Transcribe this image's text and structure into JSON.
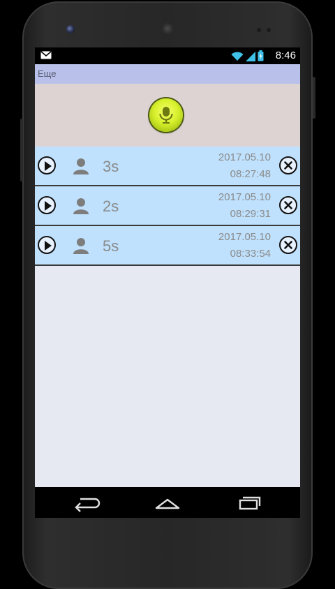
{
  "statusbar": {
    "time": "8:46",
    "icons": [
      "gmail-icon",
      "wifi-icon",
      "signal-icon",
      "battery-icon"
    ]
  },
  "actionbar": {
    "label": "Еще"
  },
  "recorder": {
    "button_icon": "microphone-icon",
    "accent": "#d7f02c"
  },
  "recordings": [
    {
      "duration": "3s",
      "date": "2017.05.10",
      "time": "08:27:48"
    },
    {
      "duration": "2s",
      "date": "2017.05.10",
      "time": "08:29:31"
    },
    {
      "duration": "5s",
      "date": "2017.05.10",
      "time": "08:33:54"
    }
  ],
  "colors": {
    "actionbar": "#b9c1ea",
    "record_area": "#ddd3d3",
    "row": "#bfe1fd",
    "background": "#e6e8f2"
  },
  "navbar": {
    "icons": [
      "back-icon",
      "home-icon",
      "recents-icon"
    ]
  }
}
